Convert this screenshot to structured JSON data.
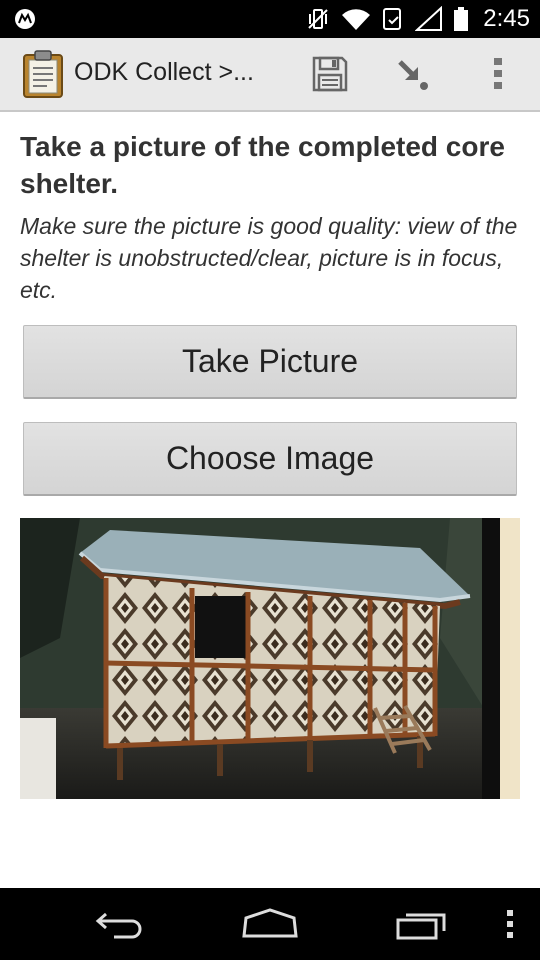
{
  "status_bar": {
    "time": "2:45",
    "icons": [
      "motorola-icon",
      "vibrate-off-icon",
      "wifi-icon",
      "nfc-icon",
      "signal-icon",
      "battery-icon"
    ]
  },
  "action_bar": {
    "title": "ODK Collect >...",
    "icons": [
      "clipboard-icon",
      "save-icon",
      "goto-icon",
      "overflow-menu-icon"
    ]
  },
  "form": {
    "question": "Take a picture of the completed core shelter.",
    "hint": "Make sure the picture is good quality: view of the shelter is unobstructed/clear, picture is in focus, etc.",
    "take_picture_label": "Take Picture",
    "choose_image_label": "Choose Image"
  },
  "nav_bar": {
    "icons": [
      "back-icon",
      "home-icon",
      "recent-apps-icon",
      "menu-icon"
    ]
  },
  "colors": {
    "status_bar": "#000000",
    "action_bar": "#e9e9e9",
    "button": "#d8d8d8",
    "text": "#333333"
  }
}
